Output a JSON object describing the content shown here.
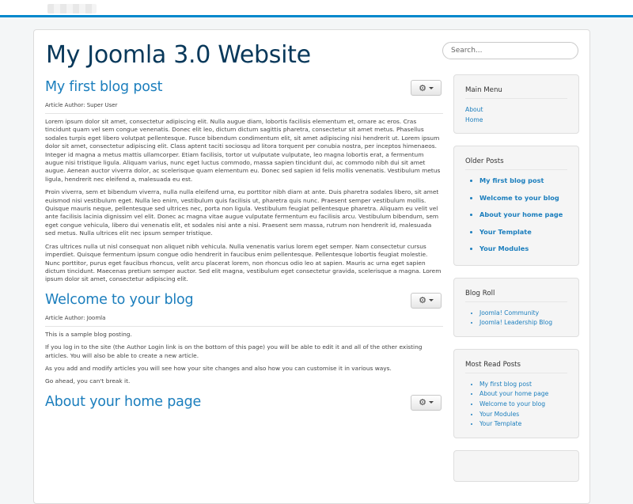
{
  "site": {
    "title": "My Joomla 3.0 Website"
  },
  "search": {
    "placeholder": "Search..."
  },
  "articles": [
    {
      "title": "My first blog post",
      "author": "Article Author: Super User",
      "paragraphs": [
        "Lorem ipsum dolor sit amet, consectetur adipiscing elit. Nulla augue diam, lobortis facilisis elementum et, ornare ac eros. Cras tincidunt quam vel sem congue venenatis. Donec elit leo, dictum dictum sagittis pharetra, consectetur sit amet metus. Phasellus sodales turpis eget libero volutpat pellentesque. Fusce bibendum condimentum elit, sit amet adipiscing nisi hendrerit ut. Lorem ipsum dolor sit amet, consectetur adipiscing elit. Class aptent taciti sociosqu ad litora torquent per conubia nostra, per inceptos himenaeos. Integer id magna a metus mattis ullamcorper. Etiam facilisis, tortor ut vulputate vulputate, leo magna lobortis erat, a fermentum augue nisi tristique ligula. Aliquam varius, nunc eget luctus commodo, massa sapien tincidunt dui, ac commodo nibh dui sit amet augue. Aenean auctor viverra dolor, ac scelerisque quam elementum eu. Donec sed sapien id felis mollis venenatis. Vestibulum metus ligula, hendrerit nec eleifend a, malesuada eu est.",
        "Proin viverra, sem et bibendum viverra, nulla nulla eleifend urna, eu porttitor nibh diam at ante. Duis pharetra sodales libero, sit amet euismod nisi vestibulum eget. Nulla leo enim, vestibulum quis facilisis ut, pharetra quis nunc. Praesent semper vestibulum mollis. Quisque mauris neque, pellentesque sed ultrices nec, porta non ligula. Vestibulum feugiat pellentesque pharetra. Aliquam eu velit vel ante facilisis lacinia dignissim vel elit. Donec ac magna vitae augue vulputate fermentum eu facilisis arcu. Vestibulum bibendum, sem eget congue vehicula, libero dui venenatis elit, et sodales nisi ante a nisi. Praesent sem massa, rutrum non hendrerit id, malesuada sed metus. Nulla ultrices elit nec ipsum semper tristique.",
        "Cras ultrices nulla ut nisl consequat non aliquet nibh vehicula. Nulla venenatis varius lorem eget semper. Nam consectetur cursus imperdiet. Quisque fermentum ipsum congue odio hendrerit in faucibus enim pellentesque. Pellentesque lobortis feugiat molestie. Nunc porttitor, purus eget faucibus rhoncus, velit arcu placerat lorem, non rhoncus odio leo at sapien. Mauris ac urna eget sapien dictum tincidunt. Maecenas pretium semper auctor. Sed elit magna, vestibulum eget consectetur gravida, scelerisque a magna. Lorem ipsum dolor sit amet, consectetur adipiscing elit."
      ]
    },
    {
      "title": "Welcome to your blog",
      "author": "Article Author: Joomla",
      "paragraphs": [
        "This is a sample blog posting.",
        "If you log in to the site (the Author Login link is on the bottom of this page) you will be able to edit it and all of the other existing articles. You will also be able to create a new article.",
        "As you add and modify articles you will see how your site changes and also how you can customise it in various ways.",
        "Go ahead, you can't break it."
      ]
    },
    {
      "title": "About your home page",
      "author": "",
      "paragraphs": []
    }
  ],
  "sidebar": {
    "main_menu": {
      "title": "Main Menu",
      "items": [
        "About",
        "Home"
      ]
    },
    "older_posts": {
      "title": "Older Posts",
      "items": [
        "My first blog post",
        "Welcome to your blog",
        "About your home page",
        "Your Template",
        "Your Modules"
      ]
    },
    "blog_roll": {
      "title": "Blog Roll",
      "items": [
        "Joomla! Community",
        "Joomla! Leadership Blog"
      ]
    },
    "most_read": {
      "title": "Most Read Posts",
      "items": [
        "My first blog post",
        "About your home page",
        "Welcome to your blog",
        "Your Modules",
        "Your Template"
      ]
    }
  },
  "icons": {
    "article_tools": "gear-icon",
    "dropdown": "caret-down-icon"
  },
  "colors": {
    "accent": "#0088cc",
    "link": "#1b7ebd",
    "title": "#08385a"
  }
}
